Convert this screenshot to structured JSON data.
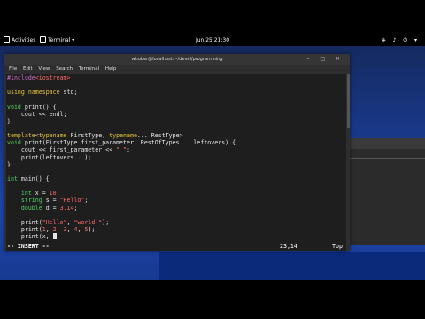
{
  "topbar": {
    "activities": "Activities",
    "app_menu": "Terminal ▾",
    "clock": "Jun 25  21:30",
    "system_icons": "⎈ ♪ ⏻ ▾"
  },
  "terminal": {
    "title": "whuber@localhost:~/devel/programming",
    "window_controls": "– □ ✕",
    "menu": [
      "File",
      "Edit",
      "View",
      "Search",
      "Terminal",
      "Help"
    ],
    "status_mode": "-- INSERT --",
    "cursor_position": "23,14",
    "scroll_position": "Top",
    "code_lines": [
      "#include<iostream>",
      "",
      "using namespace std;",
      "",
      "void print() {",
      "    cout << endl;",
      "}",
      "",
      "template<typename FirstType, typename... RestType>",
      "void print(FirstType first_parameter, RestOfTypes... leftovers) {",
      "    cout << first_parameter << \" \";",
      "    print(leftovers...);",
      "}",
      "",
      "int main() {",
      "",
      "    int x = 10;",
      "    string s = \"Hello\";",
      "    double d = 3.14;",
      "",
      "    print(\"Hello\", \"world!\");",
      "    print(1, 2, 3, 4, 5);",
      "    print(x, "
    ]
  }
}
